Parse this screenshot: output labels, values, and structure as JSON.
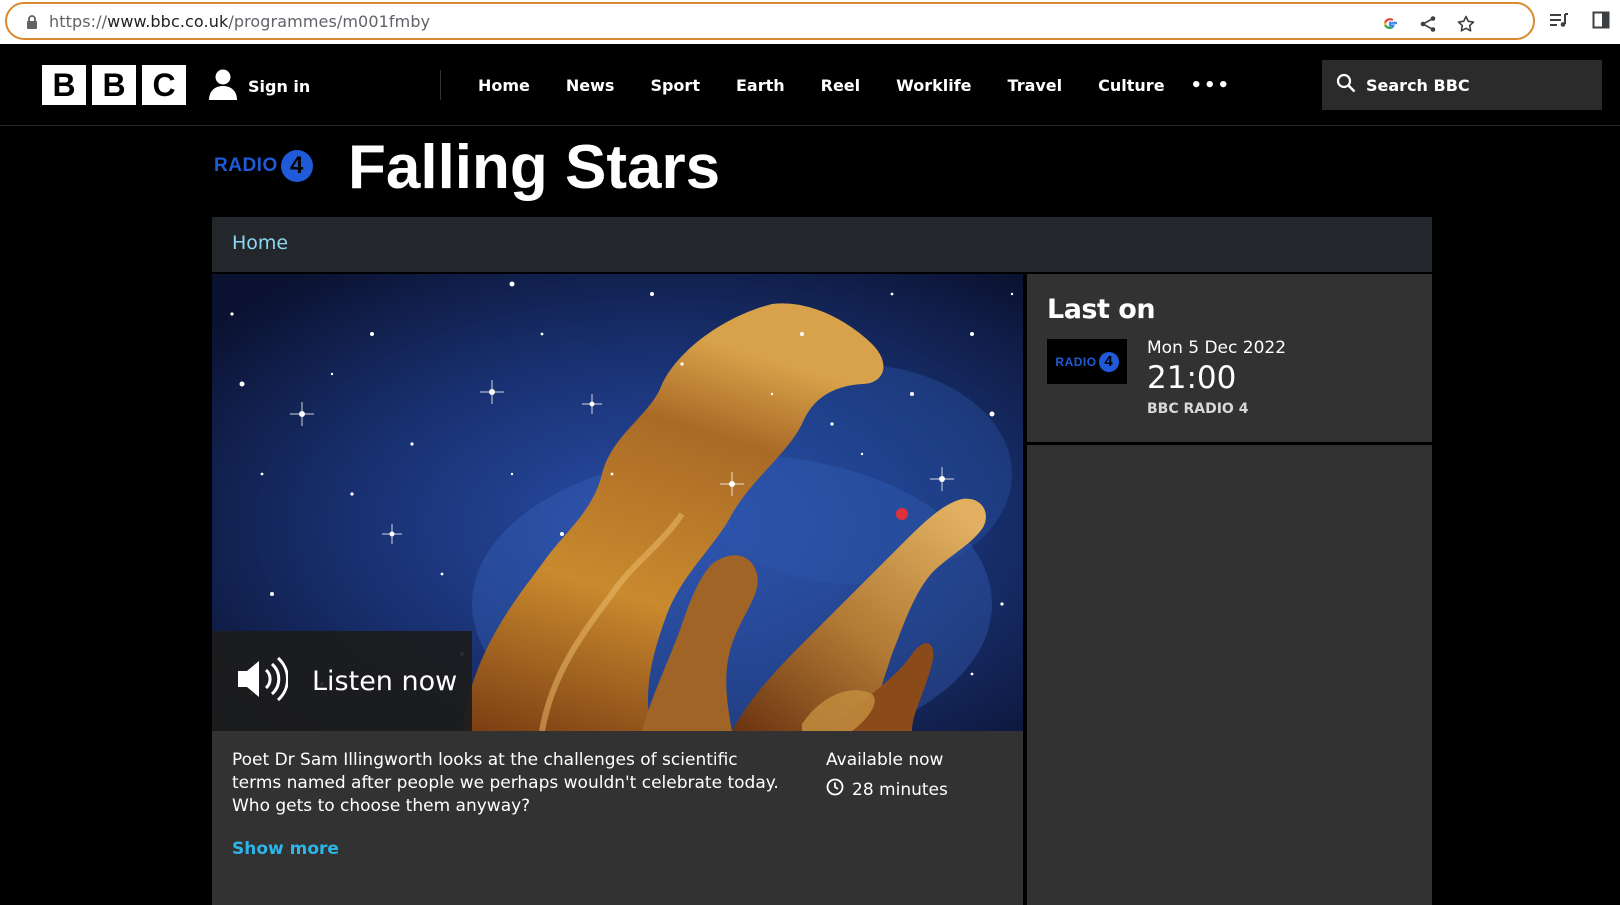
{
  "browser": {
    "url_scheme": "https://",
    "url_host": "www.bbc.co.uk",
    "url_path": "/programmes/m001fmby",
    "icons": [
      "lock-icon",
      "google-icon",
      "share-icon",
      "star-icon",
      "reading-list-icon",
      "side-panel-icon"
    ]
  },
  "masthead": {
    "logo_letters": [
      "B",
      "B",
      "C"
    ],
    "signin_label": "Sign in",
    "nav": [
      {
        "label": "Home"
      },
      {
        "label": "News"
      },
      {
        "label": "Sport"
      },
      {
        "label": "Earth"
      },
      {
        "label": "Reel"
      },
      {
        "label": "Worklife"
      },
      {
        "label": "Travel"
      },
      {
        "label": "Culture"
      }
    ],
    "more_label": "•••",
    "search_label": "Search BBC"
  },
  "programme": {
    "network_logo_text": "RADIO",
    "network_logo_number": "4",
    "title": "Falling Stars",
    "breadcrumb_home": "Home"
  },
  "player": {
    "listen_label": "Listen now"
  },
  "synopsis": {
    "text": "Poet Dr Sam Illingworth looks at the challenges of scientific terms named after people we perhaps wouldn't celebrate today. Who gets to choose them anyway?",
    "show_more": "Show more",
    "availability": "Available now",
    "duration": "28 minutes"
  },
  "last_on": {
    "heading": "Last on",
    "date": "Mon 5 Dec 2022",
    "time": "21:00",
    "station": "BBC RADIO 4"
  },
  "colors": {
    "brand_blue": "#1f5bd8",
    "link_cyan": "#2cb5e8",
    "breadcrumb_link": "#8fd6f2",
    "panel": "#323232",
    "address_bar_focus": "#d98a2e"
  }
}
